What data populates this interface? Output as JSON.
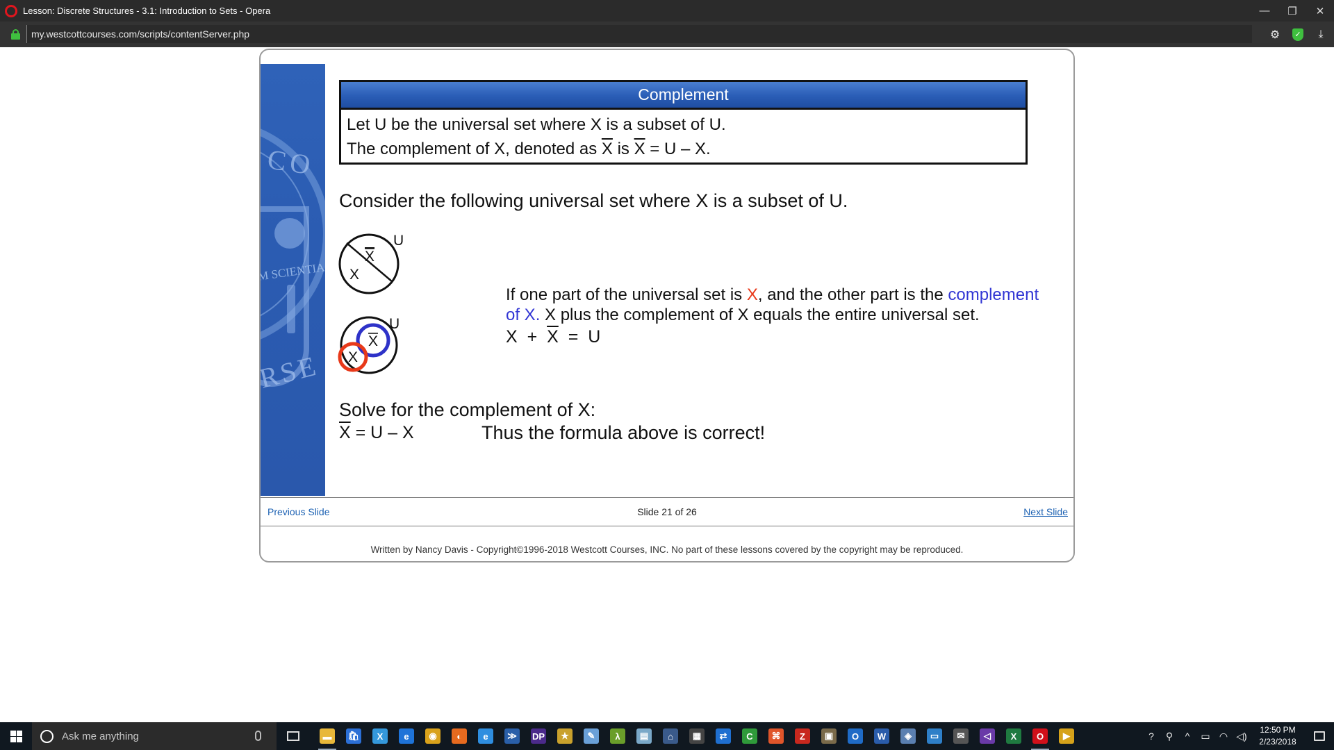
{
  "window": {
    "title": "Lesson: Discrete Structures - 3.1: Introduction to Sets - Opera",
    "minimize": "—",
    "restore": "❐",
    "close": "✕"
  },
  "address_bar": {
    "url": "my.westcottcourses.com/scripts/contentServer.php"
  },
  "slide": {
    "sidebar_seal": {
      "top": "CO",
      "middle": "M SCIENTIA",
      "bottom": "RSE"
    },
    "definition": {
      "header": "Complement",
      "line1": "Let U be the universal set where X is a subset of U.",
      "line2_a": "The complement of X, denoted as ",
      "line2_x1": "X",
      "line2_b": " is ",
      "line2_x2": "X",
      "line2_c": " = U – X."
    },
    "consider": "Consider the following universal set where X is a subset of U.",
    "venn1": {
      "universe": "U",
      "set": "X",
      "complement": "X"
    },
    "venn2": {
      "universe": "U",
      "set": "X",
      "complement": "X"
    },
    "explanation": {
      "part1": "If one part of the universal set is ",
      "x_red": "X",
      "part2": ", and the other part is the ",
      "complement_blue_1": "complement",
      "complement_blue_2": "of X.",
      "part3": "  X plus the complement of X equals the entire universal set.",
      "eq_x": "X",
      "eq_plus": "+",
      "eq_xbar": "X",
      "eq_equals": "=",
      "eq_u": "U"
    },
    "solve": {
      "heading": "Solve for the complement of X:",
      "eq_xbar": "X",
      "eq_rest": " = U – X",
      "conclusion": "Thus the formula above is correct!"
    },
    "colors": {
      "red": "#e8391a",
      "blue": "#3236d4",
      "header_blue": "#2a5db6"
    }
  },
  "nav": {
    "previous": "Previous Slide",
    "position": "Slide 21 of 26",
    "next": "Next Slide"
  },
  "footer": "Written by Nancy Davis - Copyright©1996-2018 Westcott Courses, INC. No part of these lessons covered by the copyright may be reproduced.",
  "taskbar": {
    "search_placeholder": "Ask me anything",
    "apps": [
      {
        "icon": "file-explorer-icon",
        "color": "#e8b83a",
        "glyph": "▬"
      },
      {
        "icon": "store-icon",
        "color": "#2b6fd6",
        "glyph": "🛍"
      },
      {
        "icon": "xamarin-icon",
        "color": "#3498db",
        "glyph": "X"
      },
      {
        "icon": "edge-icon",
        "color": "#1e73d8",
        "glyph": "e"
      },
      {
        "icon": "chrome-icon",
        "color": "#d9a21b",
        "glyph": "◉"
      },
      {
        "icon": "firefox-icon",
        "color": "#e66a1f",
        "glyph": "◐"
      },
      {
        "icon": "ie-icon",
        "color": "#2e8ee0",
        "glyph": "e"
      },
      {
        "icon": "powershell-icon",
        "color": "#2a5fa8",
        "glyph": "≫"
      },
      {
        "icon": "dreamweaver-icon",
        "color": "#4b2a8a",
        "glyph": "DP"
      },
      {
        "icon": "star-app-icon",
        "color": "#c9a12c",
        "glyph": "★"
      },
      {
        "icon": "paint-icon",
        "color": "#6aa0d8",
        "glyph": "✎"
      },
      {
        "icon": "lambda-icon",
        "color": "#6a9e2a",
        "glyph": "λ"
      },
      {
        "icon": "notes-icon",
        "color": "#7aa8c8",
        "glyph": "▤"
      },
      {
        "icon": "network-icon",
        "color": "#3a5a8a",
        "glyph": "⌂"
      },
      {
        "icon": "calculator-icon",
        "color": "#444444",
        "glyph": "▦"
      },
      {
        "icon": "teamviewer-icon",
        "color": "#1f6fd0",
        "glyph": "⇄"
      },
      {
        "icon": "camtasia-icon",
        "color": "#2f9a3a",
        "glyph": "C"
      },
      {
        "icon": "tool-icon",
        "color": "#e0552a",
        "glyph": "⌘"
      },
      {
        "icon": "filezilla-icon",
        "color": "#c8281e",
        "glyph": "Z"
      },
      {
        "icon": "media-icon",
        "color": "#7a6a4a",
        "glyph": "▣"
      },
      {
        "icon": "outlook-icon",
        "color": "#1f6bc6",
        "glyph": "O"
      },
      {
        "icon": "word-icon",
        "color": "#2a5caa",
        "glyph": "W"
      },
      {
        "icon": "vmware-icon",
        "color": "#5a7fb0",
        "glyph": "◈"
      },
      {
        "icon": "remote-desktop-icon",
        "color": "#2e7fc8",
        "glyph": "▭"
      },
      {
        "icon": "mail-icon",
        "color": "#555555",
        "glyph": "✉"
      },
      {
        "icon": "visual-studio-icon",
        "color": "#6a3aa8",
        "glyph": "◁"
      },
      {
        "icon": "excel-icon",
        "color": "#1f7a40",
        "glyph": "X"
      },
      {
        "icon": "opera-icon",
        "color": "#d0101a",
        "glyph": "O"
      },
      {
        "icon": "slides-app-icon",
        "color": "#d6a21a",
        "glyph": "▶"
      }
    ],
    "clock_time": "12:50 PM",
    "clock_date": "2/23/2018"
  }
}
